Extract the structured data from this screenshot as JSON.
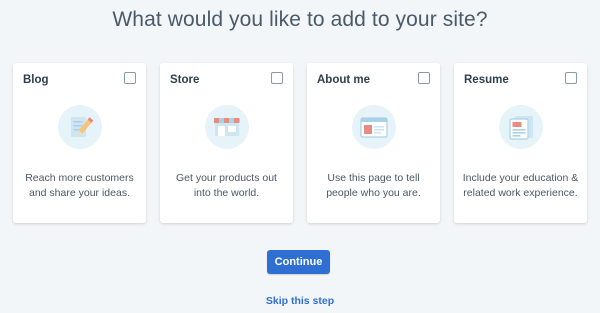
{
  "page": {
    "heading": "What would you like to add to your site?"
  },
  "cards": [
    {
      "title": "Blog",
      "description": "Reach more customers and share your ideas.",
      "checked": false,
      "icon": "blog-pencil-icon"
    },
    {
      "title": "Store",
      "description": "Get your products out into the world.",
      "checked": false,
      "icon": "storefront-icon"
    },
    {
      "title": "About me",
      "description": "Use this page to tell people who you are.",
      "checked": false,
      "icon": "about-page-icon"
    },
    {
      "title": "Resume",
      "description": "Include your education & related work experience.",
      "checked": false,
      "icon": "resume-document-icon"
    }
  ],
  "actions": {
    "continue_label": "Continue",
    "skip_label": "Skip this step"
  },
  "colors": {
    "background": "#f3f6f8",
    "card": "#ffffff",
    "accent": "#2f6fd3",
    "illustration_circle": "#e6f3f9"
  }
}
